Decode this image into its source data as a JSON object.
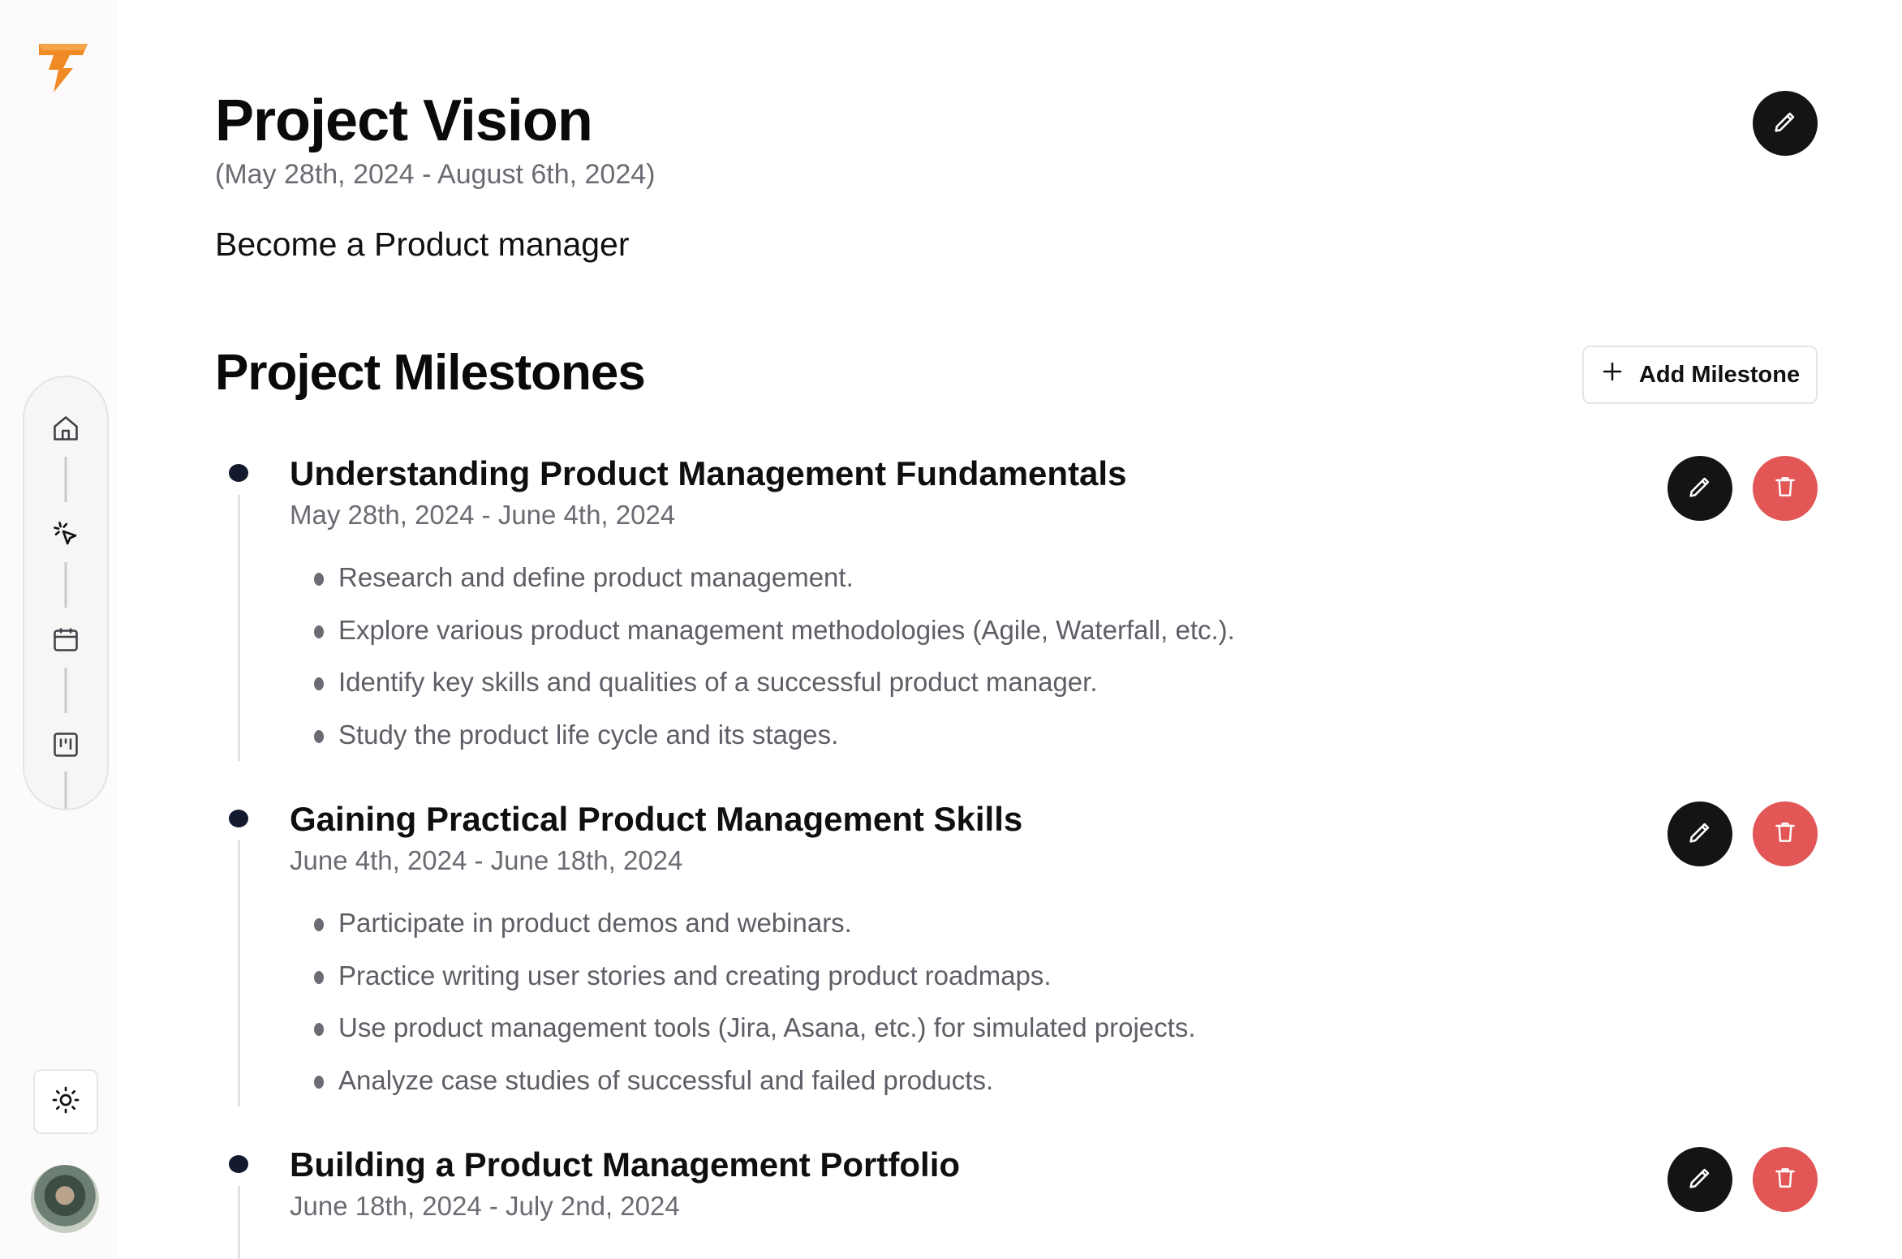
{
  "project": {
    "title": "Project Vision",
    "dates": "(May 28th, 2024 - August 6th, 2024)",
    "goal": "Become a Product manager"
  },
  "icons": {
    "logo": "lightning-bolt-logo",
    "edit": "pencil-icon",
    "delete": "trash-icon",
    "add": "plus-icon",
    "home": "home-icon",
    "cursor": "cursor-click-icon",
    "calendar": "calendar-icon",
    "board": "kanban-board-icon",
    "theme": "sun-icon"
  },
  "colors": {
    "brand": "#f08a24",
    "dark_button": "#141414",
    "delete_button": "#e25656",
    "timeline_dot": "#131a2e"
  },
  "milestones_section": {
    "title": "Project Milestones",
    "add_label": "Add Milestone"
  },
  "milestones": [
    {
      "title": "Understanding Product Management Fundamentals",
      "dates": "May 28th, 2024 - June 4th, 2024",
      "tasks": [
        "Research and define product management.",
        "Explore various product management methodologies (Agile, Waterfall, etc.).",
        "Identify key skills and qualities of a successful product manager.",
        "Study the product life cycle and its stages."
      ]
    },
    {
      "title": "Gaining Practical Product Management Skills",
      "dates": "June 4th, 2024 - June 18th, 2024",
      "tasks": [
        "Participate in product demos and webinars.",
        "Practice writing user stories and creating product roadmaps.",
        "Use product management tools (Jira, Asana, etc.) for simulated projects.",
        "Analyze case studies of successful and failed products."
      ]
    },
    {
      "title": "Building a Product Management Portfolio",
      "dates": "June 18th, 2024 - July 2nd, 2024",
      "tasks": []
    }
  ]
}
